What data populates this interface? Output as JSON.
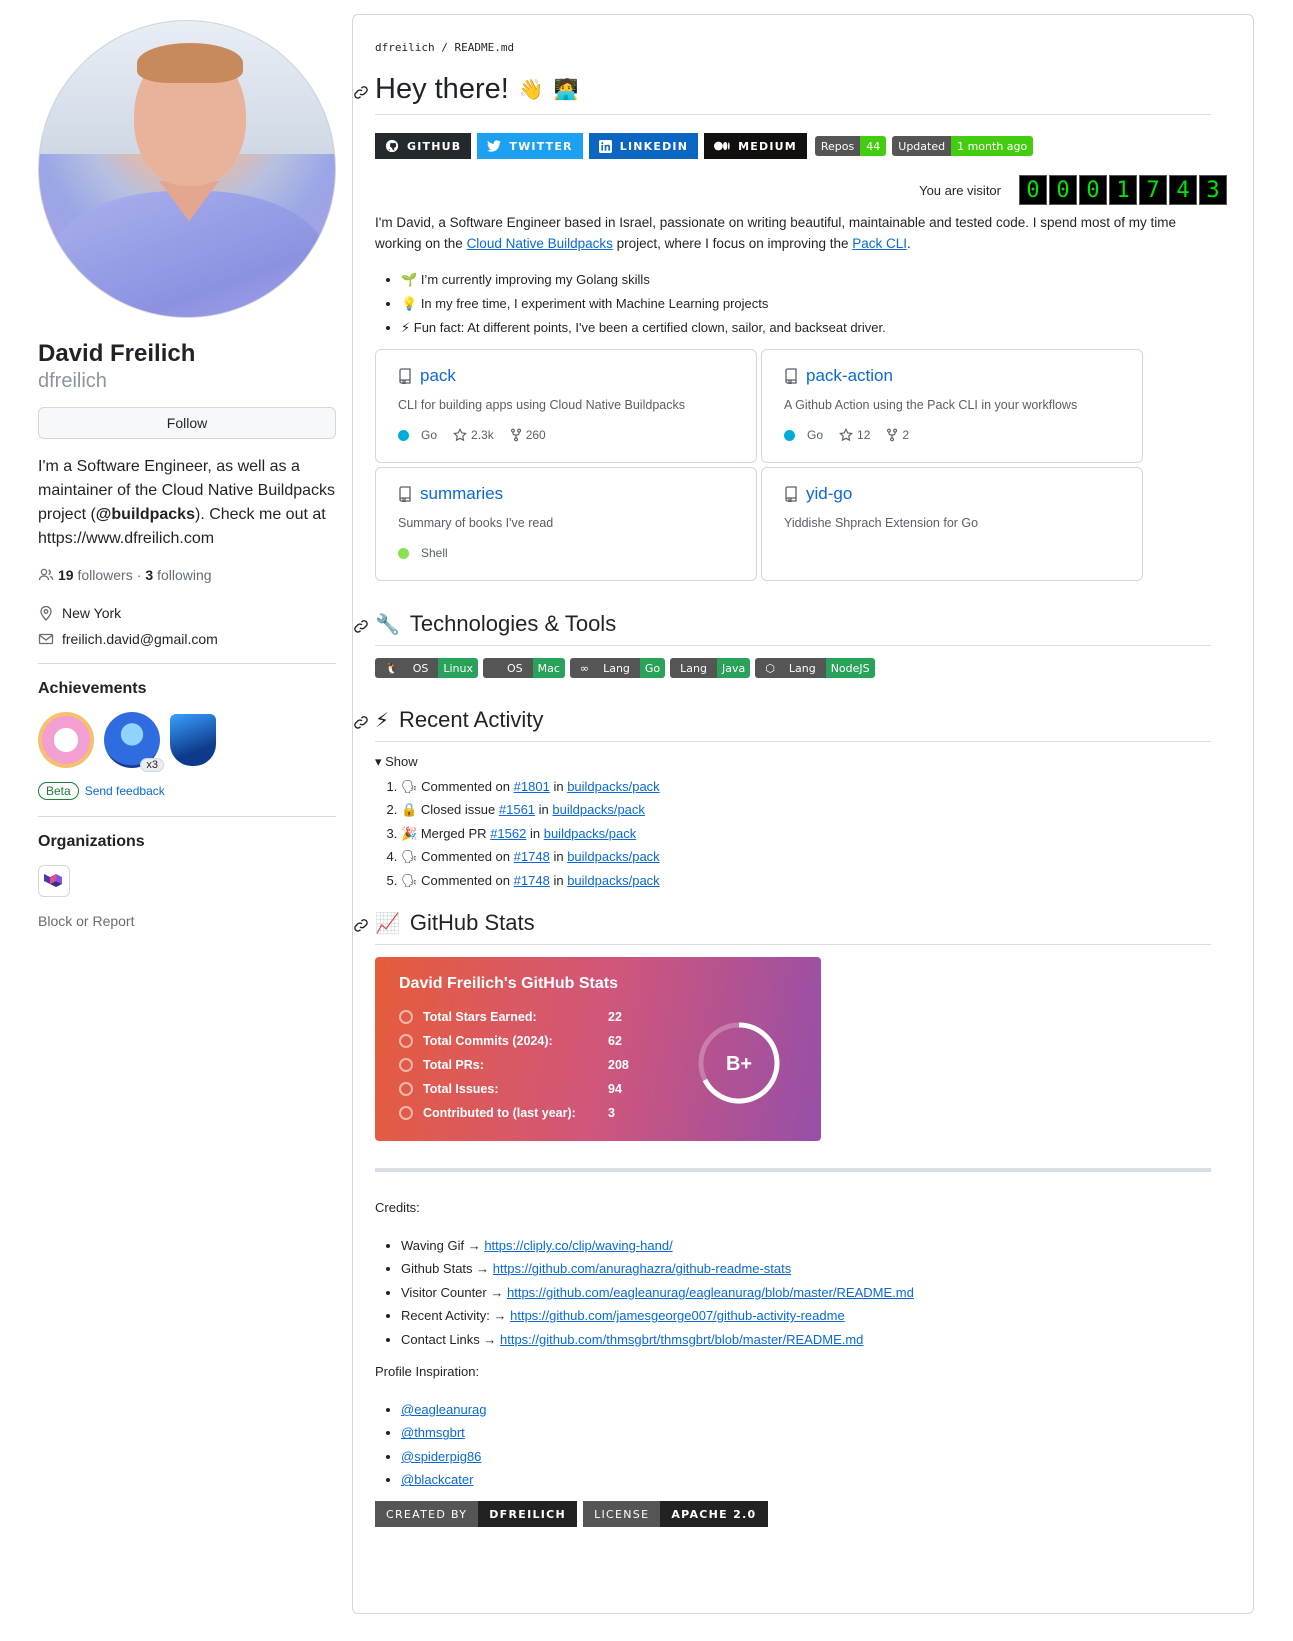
{
  "profile": {
    "name": "David Freilich",
    "login": "dfreilich",
    "follow_label": "Follow",
    "bio_1": "I'm a Software Engineer, as well as a maintainer of the Cloud Native Buildpacks project (",
    "bio_handle": "@buildpacks",
    "bio_2": "). Check me out at https://www.dfreilich.com",
    "followers": "19",
    "followers_label": "followers",
    "following": "3",
    "following_label": "following",
    "location": "New York",
    "email": "freilich.david@gmail.com",
    "achievements_title": "Achievements",
    "achievement_count": "x3",
    "beta_label": "Beta",
    "feedback_label": "Send feedback",
    "orgs_title": "Organizations",
    "block_label": "Block or Report"
  },
  "readme": {
    "path_user": "dfreilich",
    "path_file": "README.md",
    "heading": "Hey there!",
    "social": [
      "GITHUB",
      "TWITTER",
      "LINKEDIN",
      "MEDIUM"
    ],
    "repos_label": "Repos",
    "repos_count": "44",
    "updated_label": "Updated",
    "updated_value": "1 month ago",
    "visitor_label": "You are visitor",
    "visitor_digits": [
      "0",
      "0",
      "0",
      "1",
      "7",
      "4",
      "3"
    ],
    "intro_1": "I'm David, a Software Engineer based in Israel, passionate on writing beautiful, maintainable and tested code. I spend most of my time working on the ",
    "intro_link1": "Cloud Native Buildpacks",
    "intro_2": " project, where I focus on improving the ",
    "intro_link2": "Pack CLI",
    "intro_3": ".",
    "bullets": [
      {
        "emoji": "🌱",
        "text": "I’m currently improving my Golang skills"
      },
      {
        "emoji": "💡",
        "text": "In my free time, I experiment with Machine Learning projects"
      },
      {
        "emoji": "⚡",
        "text": "Fun fact: At different points, I've been a certified clown, sailor, and backseat driver."
      }
    ]
  },
  "pins": [
    {
      "name": "pack",
      "desc": "CLI for building apps using Cloud Native Buildpacks",
      "lang": "Go",
      "color": "#00ADD8",
      "stars": "2.3k",
      "forks": "260"
    },
    {
      "name": "pack-action",
      "desc": "A Github Action using the Pack CLI in your workflows",
      "lang": "Go",
      "color": "#00ADD8",
      "stars": "12",
      "forks": "2"
    },
    {
      "name": "summaries",
      "desc": "Summary of books I've read",
      "lang": "Shell",
      "color": "#89e051",
      "stars": "",
      "forks": ""
    },
    {
      "name": "yid-go",
      "desc": "Yiddishe Shprach Extension for Go",
      "lang": "",
      "color": "",
      "stars": "",
      "forks": ""
    }
  ],
  "tech": {
    "heading": "Technologies & Tools",
    "badges": [
      {
        "l": "OS",
        "r": "Linux"
      },
      {
        "l": "OS",
        "r": "Mac"
      },
      {
        "l": "Lang",
        "r": "Go"
      },
      {
        "l": "Lang",
        "r": "Java"
      },
      {
        "l": "Lang",
        "r": "NodeJS"
      }
    ]
  },
  "activity": {
    "heading": "Recent Activity",
    "show_label": "Show",
    "items": [
      {
        "emoji": "🗣",
        "action": "Commented on",
        "num": "#1801",
        "repo": "buildpacks/pack"
      },
      {
        "emoji": "🔒",
        "action": "Closed issue",
        "num": "#1561",
        "repo": "buildpacks/pack"
      },
      {
        "emoji": "🎉",
        "action": "Merged PR",
        "num": "#1562",
        "repo": "buildpacks/pack"
      },
      {
        "emoji": "🗣",
        "action": "Commented on",
        "num": "#1748",
        "repo": "buildpacks/pack"
      },
      {
        "emoji": "🗣",
        "action": "Commented on",
        "num": "#1748",
        "repo": "buildpacks/pack"
      }
    ],
    "in_label": "in"
  },
  "stats": {
    "heading": "GitHub Stats",
    "card_title": "David Freilich's GitHub Stats",
    "rows": [
      {
        "k": "Total Stars Earned:",
        "v": "22"
      },
      {
        "k": "Total Commits (2024):",
        "v": "62"
      },
      {
        "k": "Total PRs:",
        "v": "208"
      },
      {
        "k": "Total Issues:",
        "v": "94"
      },
      {
        "k": "Contributed to (last year):",
        "v": "3"
      }
    ],
    "grade": "B+"
  },
  "credits": {
    "label": "Credits:",
    "items": [
      {
        "k": "Waving Gif →",
        "url": "https://cliply.co/clip/waving-hand/"
      },
      {
        "k": "Github Stats →",
        "url": "https://github.com/anuraghazra/github-readme-stats"
      },
      {
        "k": "Visitor Counter →",
        "url": "https://github.com/eagleanurag/eagleanurag/blob/master/README.md"
      },
      {
        "k": "Recent Activity: →",
        "url": "https://github.com/jamesgeorge007/github-activity-readme"
      },
      {
        "k": "Contact Links →",
        "url": "https://github.com/thmsgbrt/thmsgbrt/blob/master/README.md"
      }
    ],
    "insp_label": "Profile Inspiration:",
    "insp": [
      "@eagleanurag",
      "@thmsgbrt",
      "@spiderpig86",
      "@blackcater"
    ],
    "footer": [
      {
        "l": "CREATED BY",
        "r": "DFREILICH"
      },
      {
        "l": "LICENSE",
        "r": "APACHE 2.0"
      }
    ]
  }
}
